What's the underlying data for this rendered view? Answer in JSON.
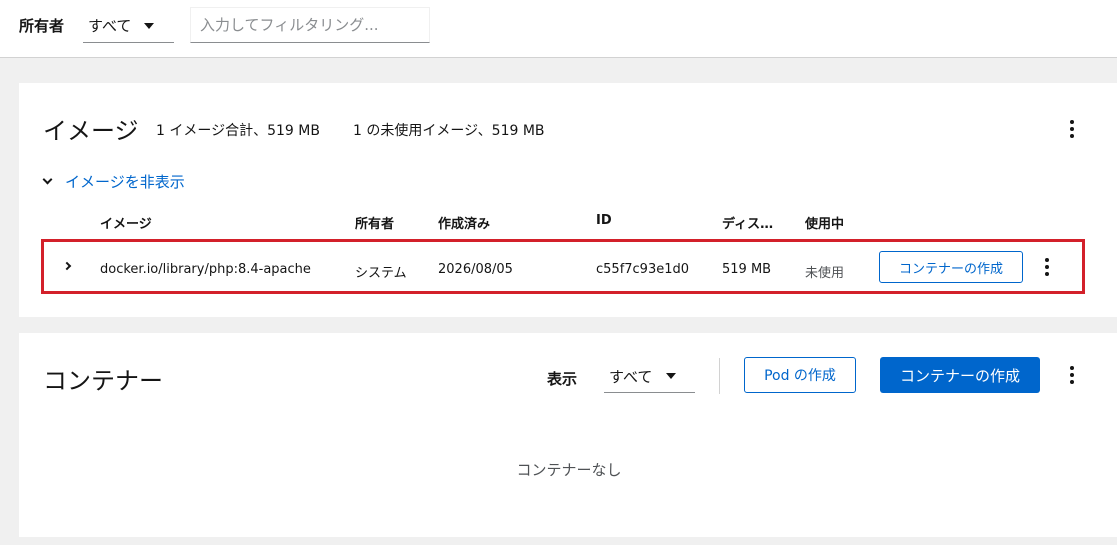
{
  "filter_bar": {
    "owner_label": "所有者",
    "owner_value": "すべて",
    "search_placeholder": "入力してフィルタリング..."
  },
  "images": {
    "title": "イメージ",
    "summary_total": "1 イメージ合計、519 MB",
    "summary_unused": "1 の未使用イメージ、519 MB",
    "toggle_label": "イメージを非表示",
    "columns": [
      "イメージ",
      "所有者",
      "作成済み",
      "ID",
      "ディス…",
      "使用中"
    ],
    "rows": [
      {
        "image": "docker.io/library/php:8.4-apache",
        "owner": "システム",
        "created": "2026/08/05",
        "id": "c55f7c93e1d0",
        "disk": "519 MB",
        "in_use": "未使用",
        "action_label": "コンテナーの作成"
      }
    ],
    "highlight_color": "#d3202a"
  },
  "containers": {
    "title": "コンテナー",
    "show_label": "表示",
    "show_value": "すべて",
    "create_pod_label": "Pod の作成",
    "create_container_label": "コンテナーの作成",
    "empty_text": "コンテナーなし"
  },
  "colors": {
    "accent": "#0066cc",
    "background": "#f0f0f0"
  }
}
